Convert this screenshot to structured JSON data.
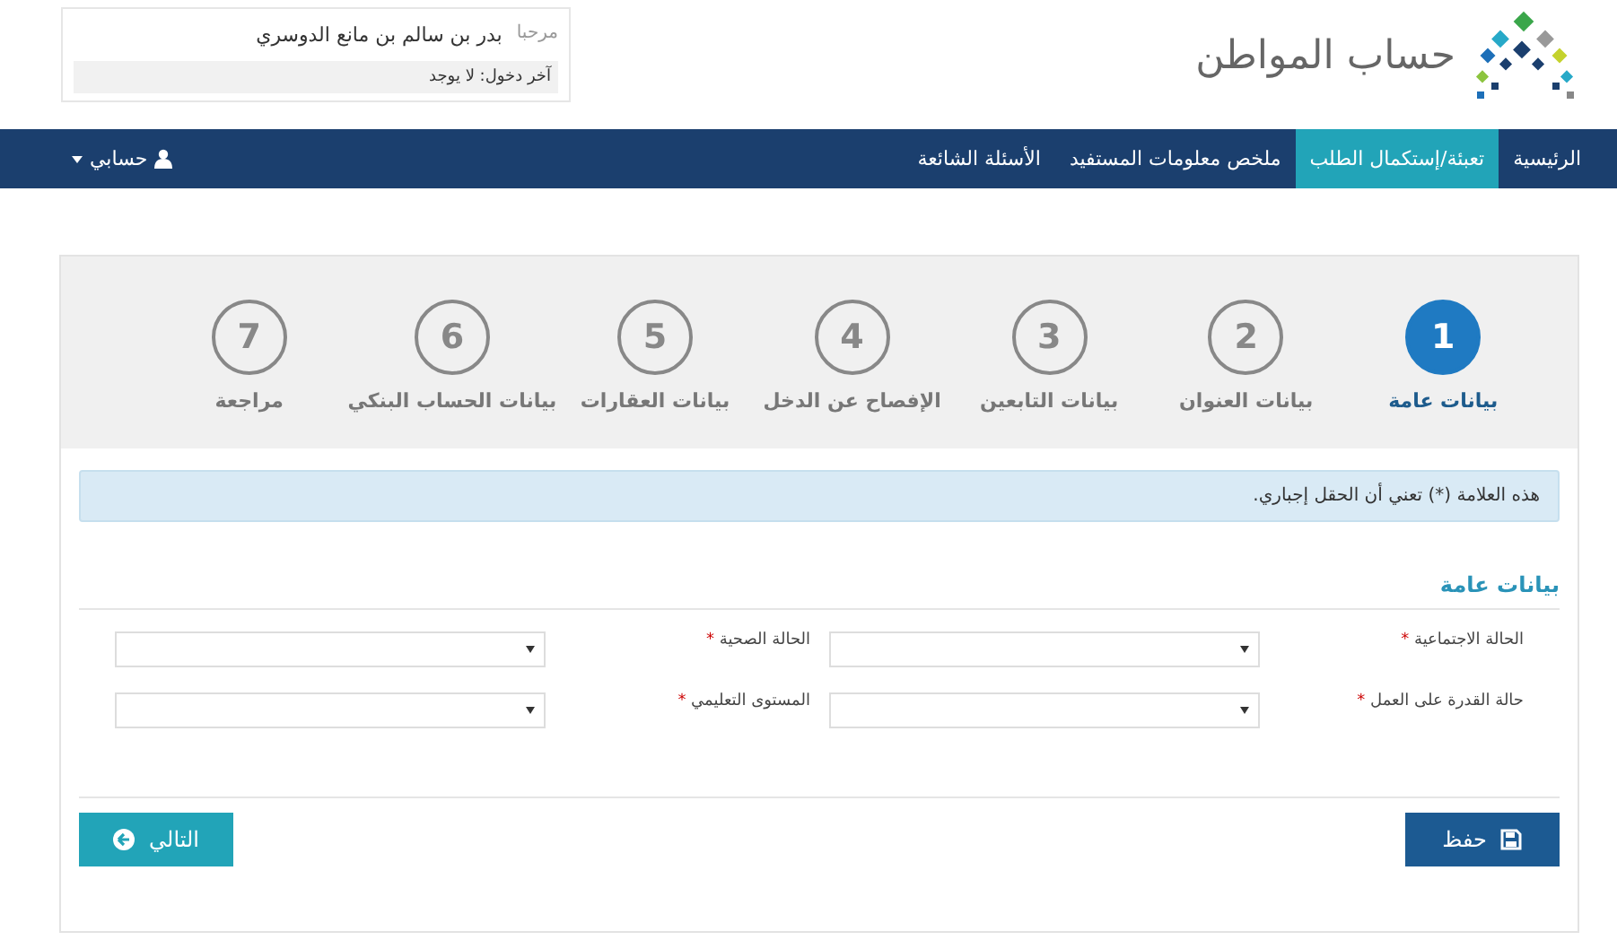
{
  "header": {
    "logo_text": "حساب المواطن",
    "greeting": "مرحبا",
    "user_name": "بدر بن سالم بن مانع الدوسري",
    "last_login": "آخر دخول: لا يوجد"
  },
  "nav": {
    "items": [
      {
        "label": "الرئيسية",
        "selected": false
      },
      {
        "label": "تعبئة/إستكمال الطلب",
        "selected": true
      },
      {
        "label": "ملخص معلومات المستفيد",
        "selected": false
      },
      {
        "label": "الأسئلة الشائعة",
        "selected": false
      }
    ],
    "account": "حسابي"
  },
  "steps": [
    {
      "number": "1",
      "label": "بيانات عامة",
      "selected": true
    },
    {
      "number": "2",
      "label": "بيانات العنوان",
      "selected": false
    },
    {
      "number": "3",
      "label": "بيانات التابعين",
      "selected": false
    },
    {
      "number": "4",
      "label": "الإفصاح عن الدخل",
      "selected": false
    },
    {
      "number": "5",
      "label": "بيانات العقارات",
      "selected": false
    },
    {
      "number": "6",
      "label": "بيانات الحساب البنكي",
      "selected": false
    },
    {
      "number": "7",
      "label": "مراجعة",
      "selected": false
    }
  ],
  "notice": "هذه العلامة (*) تعني أن الحقل إجباري.",
  "section_title": "بيانات عامة",
  "fields": [
    {
      "label": "الحالة الاجتماعية",
      "mark": "*"
    },
    {
      "label": "الحالة الصحية",
      "mark": "*"
    },
    {
      "label": "حالة القدرة على العمل",
      "mark": "*"
    },
    {
      "label": "المستوى التعليمي",
      "mark": "*"
    }
  ],
  "buttons": {
    "save": "حفظ",
    "next": "التالي"
  }
}
